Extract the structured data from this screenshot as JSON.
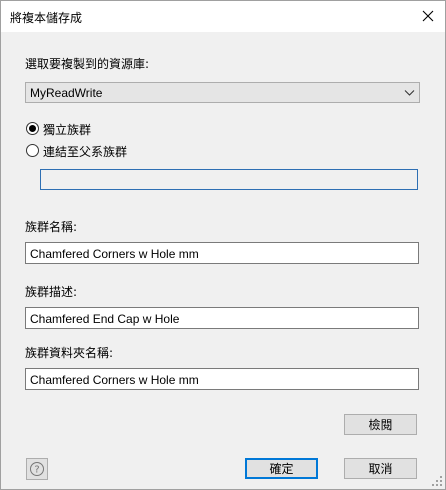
{
  "window": {
    "title": "將複本儲存成"
  },
  "library": {
    "label": "選取要複製到的資源庫:",
    "selected": "MyReadWrite"
  },
  "family_mode": {
    "standalone_label": "獨立族群",
    "standalone_checked": true,
    "link_parent_label": "連結至父系族群",
    "link_parent_checked": false,
    "parent_value": ""
  },
  "family_name": {
    "label": "族群名稱:",
    "value": "Chamfered Corners w Hole mm"
  },
  "family_description": {
    "label": "族群描述:",
    "value": "Chamfered End Cap w Hole"
  },
  "folder_name": {
    "label": "族群資料夾名稱:",
    "value": "Chamfered Corners w Hole mm"
  },
  "buttons": {
    "browse": "檢閱",
    "ok": "確定",
    "cancel": "取消"
  },
  "colors": {
    "dialog_bg": "#f0f0f0",
    "focus_blue": "#0078d7",
    "input_border": "#7a7a7a"
  }
}
